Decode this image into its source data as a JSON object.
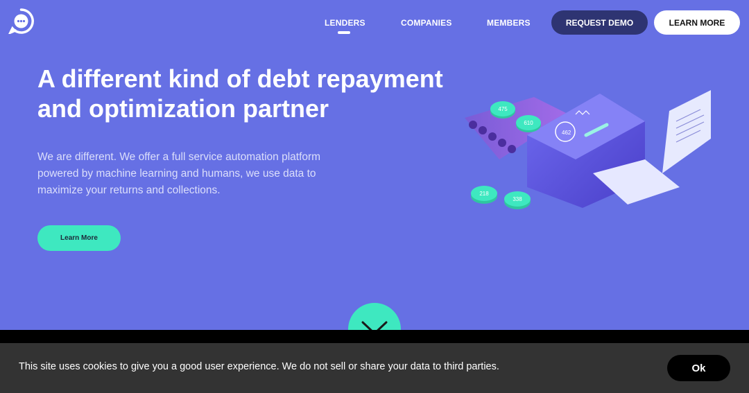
{
  "nav": {
    "links": [
      "LENDERS",
      "COMPANIES",
      "MEMBERS"
    ],
    "active": "LENDERS",
    "request_demo": "REQUEST DEMO",
    "learn_more": "LEARN MORE"
  },
  "hero": {
    "headline": "A different kind of debt repayment and optimization partner",
    "subtext": "We are different. We offer a full service automation platform powered by machine learning and humans, we use data to maximize your returns and collections.",
    "cta": "Learn More"
  },
  "illustration": {
    "coins": [
      "475",
      "610",
      "218",
      "338"
    ],
    "gauge": "462"
  },
  "cookie": {
    "message": "This site uses cookies to give you a good user experience. We do not sell or share your data to third parties.",
    "ok": "Ok"
  },
  "colors": {
    "background": "#6670E4",
    "accent": "#3EE8C0",
    "demo_button": "#2E3472",
    "cookie_bar": "#333333"
  }
}
